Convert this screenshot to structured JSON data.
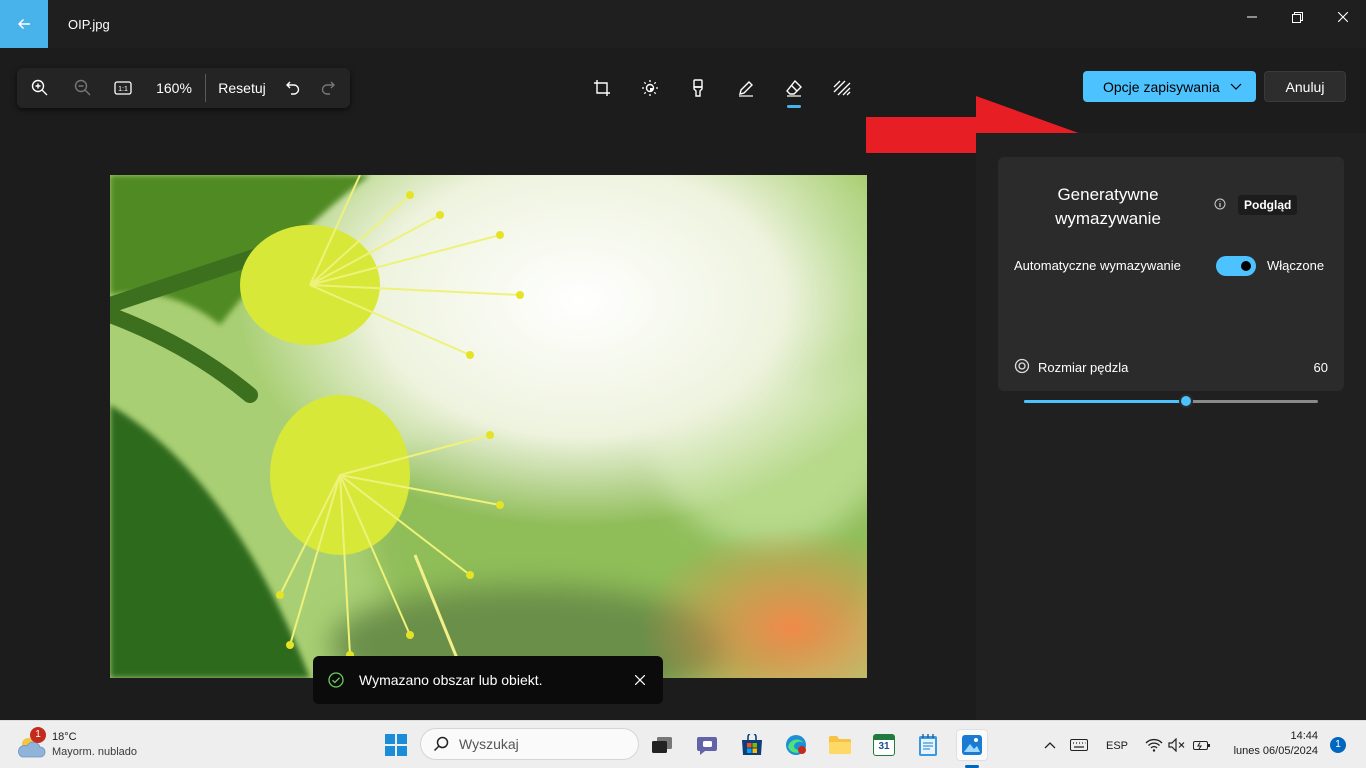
{
  "window": {
    "title": "OIP.jpg",
    "back_icon": "arrow-left-icon",
    "controls": [
      "minimize-icon",
      "restore-icon",
      "close-icon"
    ]
  },
  "zoom_bar": {
    "zoom_value": "160%",
    "reset_label": "Resetuj",
    "icons": [
      "zoom-in-icon",
      "zoom-out-icon",
      "actual-size-icon",
      "undo-icon",
      "redo-icon"
    ]
  },
  "edit_tools": {
    "icons": [
      "crop-icon",
      "brightness-icon",
      "retouch-icon",
      "markup-icon",
      "eraser-icon",
      "background-icon"
    ],
    "active": "eraser-icon"
  },
  "actions": {
    "save_label": "Opcje zapisywania",
    "cancel_label": "Anuluj"
  },
  "panel": {
    "title_line1": "Generatywne",
    "title_line2": "wymazywanie",
    "badge": "Podgląd",
    "auto_erase_label": "Automatyczne wymazywanie",
    "auto_erase_state": "Włączone",
    "auto_erase_on": true,
    "brush_label": "Rozmiar pędzla",
    "brush_value": "60",
    "brush_fraction": 0.55
  },
  "toast": {
    "message": "Wymazano obszar lub obiekt."
  },
  "taskbar": {
    "weather_badge": "1",
    "temperature": "18°C",
    "weather_desc": "Mayorm. nublado",
    "search_placeholder": "Wyszukaj",
    "language": "ESP",
    "time": "14:44",
    "date": "lunes 06/05/2024",
    "notification_count": "1",
    "calendar_day": "31"
  },
  "colors": {
    "accent": "#4cc2ff",
    "back_button": "#47b3ea",
    "arrow_red": "#e81e25",
    "background": "#1c1c1c",
    "panel": "#2b2b2b"
  }
}
